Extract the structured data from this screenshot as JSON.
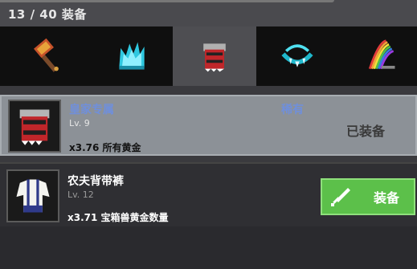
{
  "inventory": {
    "capacity_label": "13 / 40 装备"
  },
  "tabs": [
    {
      "icon": "hammer-icon",
      "active": false
    },
    {
      "icon": "ice-crown-icon",
      "active": false
    },
    {
      "icon": "armor-icon",
      "active": true
    },
    {
      "icon": "fang-necklace-icon",
      "active": false
    },
    {
      "icon": "rainbow-sword-icon",
      "active": false
    }
  ],
  "items": [
    {
      "name": "皇家专属",
      "level": "Lv. 9",
      "bonus": "x3.76 所有黄金",
      "rarity": "稀有",
      "status": "已装备",
      "icon": "royal-armor-icon"
    },
    {
      "name": "农夫背带裤",
      "level": "Lv. 12",
      "bonus": "x3.71 宝箱兽黄金数量",
      "button_label": "装备",
      "icon": "overalls-icon"
    }
  ],
  "colors": {
    "rarity_blue": "#6f8fdc",
    "equip_green": "#5cc04a"
  }
}
